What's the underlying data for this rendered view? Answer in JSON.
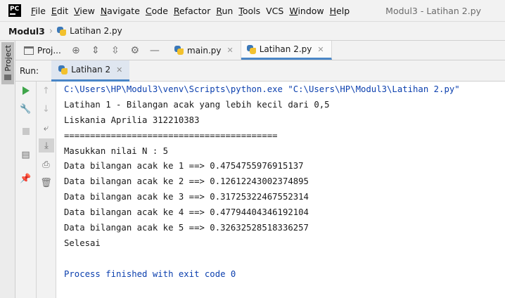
{
  "app": {
    "logo_text": "PC",
    "window_title": "Modul3 - Latihan 2.py"
  },
  "menu": [
    {
      "u": "F",
      "rest": "ile"
    },
    {
      "u": "E",
      "rest": "dit"
    },
    {
      "u": "V",
      "rest": "iew"
    },
    {
      "u": "N",
      "rest": "avigate"
    },
    {
      "u": "C",
      "rest": "ode"
    },
    {
      "u": "R",
      "rest": "efactor"
    },
    {
      "u": "R",
      "rest": "un"
    },
    {
      "u": "T",
      "rest": "ools"
    },
    {
      "u": "",
      "rest": "VCS"
    },
    {
      "u": "W",
      "rest": "indow"
    },
    {
      "u": "H",
      "rest": "elp"
    }
  ],
  "breadcrumb": {
    "project": "Modul3",
    "file": "Latihan 2.py"
  },
  "tool_strip": {
    "project_tab": "Project"
  },
  "project_toolbar": {
    "label": "Proj..."
  },
  "editor_tabs": [
    {
      "label": "main.py",
      "active": false
    },
    {
      "label": "Latihan 2.py",
      "active": true
    }
  ],
  "run": {
    "label": "Run:",
    "tab_label": "Latihan 2"
  },
  "console": {
    "command": "C:\\Users\\HP\\Modul3\\venv\\Scripts\\python.exe \"C:\\Users\\HP\\Modul3\\Latihan 2.py\"",
    "lines": [
      "Latihan 1 - Bilangan acak yang lebih kecil dari 0,5",
      "Liskania Aprilia 312210383",
      "=========================================",
      "Masukkan nilai N : 5",
      "Data bilangan acak ke 1 ==> 0.4754755976915137",
      "Data bilangan acak ke 2 ==> 0.12612243002374895",
      "Data bilangan acak ke 3 ==> 0.31725322467552314",
      "Data bilangan acak ke 4 ==> 0.47794404346192104",
      "Data bilangan acak ke 5 ==> 0.32632528518336257",
      "Selesai",
      ""
    ],
    "exit_message": "Process finished with exit code 0"
  }
}
